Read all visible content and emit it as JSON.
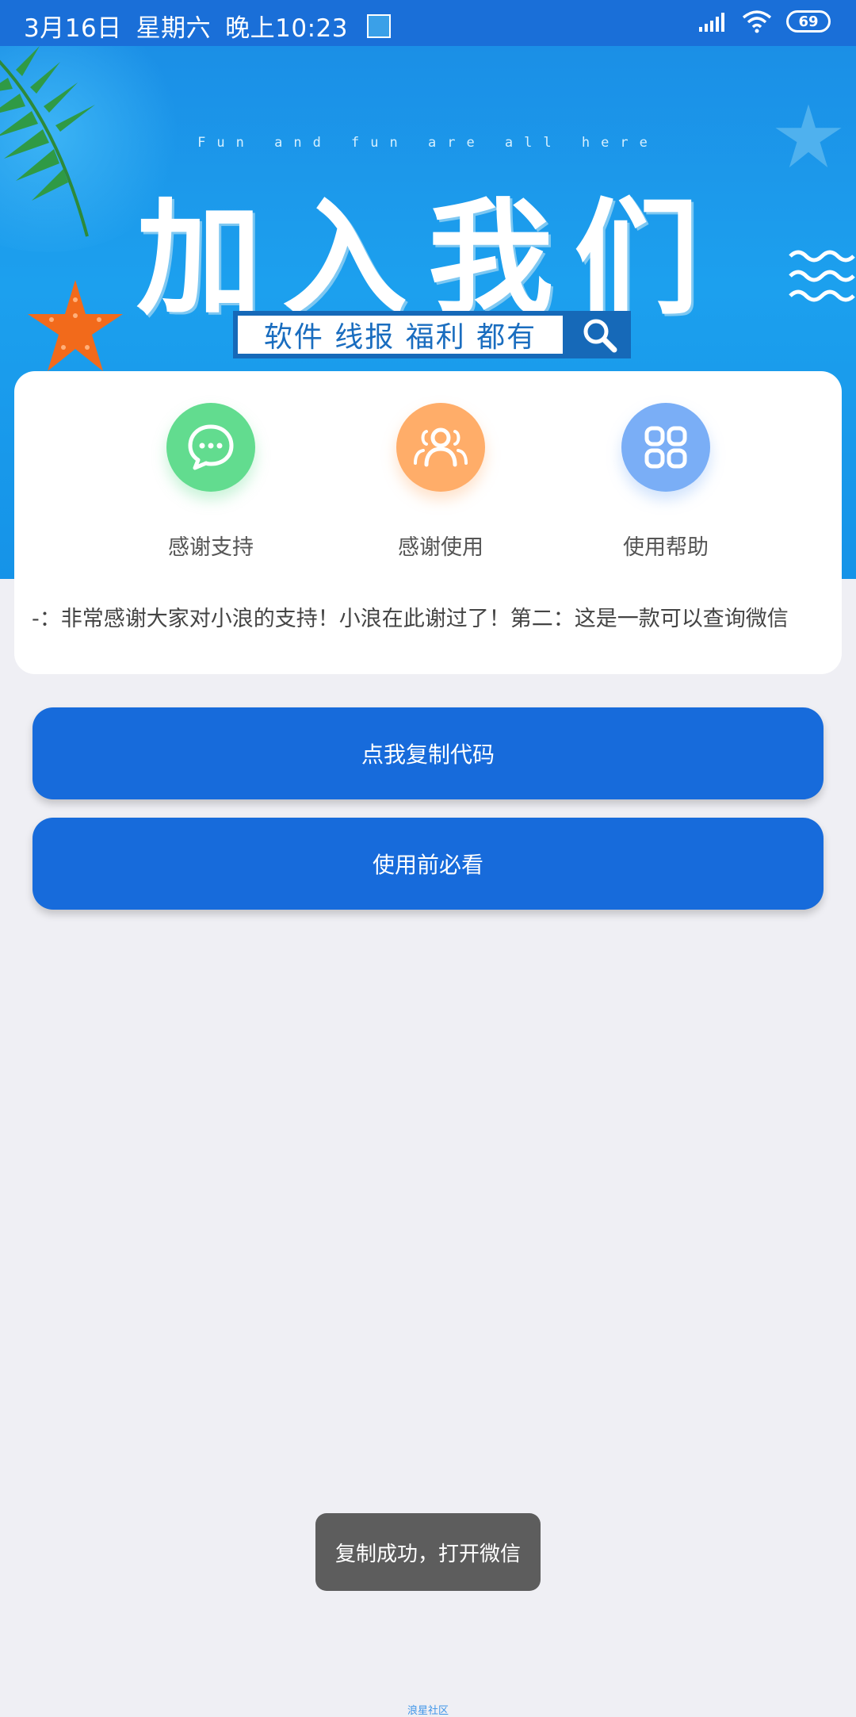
{
  "status_bar": {
    "date": "3月16日",
    "weekday": "星期六",
    "time": "晚上10:23",
    "battery": "69"
  },
  "banner": {
    "subtitle": "Fun and fun are all here",
    "title": "加入我们",
    "search_text": "软件 线报 福利 都有"
  },
  "features": [
    {
      "label": "感谢支持",
      "icon": "chat-icon",
      "color": "#62dc8f"
    },
    {
      "label": "感谢使用",
      "icon": "users-icon",
      "color": "#ffad69"
    },
    {
      "label": "使用帮助",
      "icon": "grid-icon",
      "color": "#7aaef6"
    }
  ],
  "notice": "-：非常感谢大家对小浪的支持！小浪在此谢过了！第二：这是一款可以查询微信",
  "buttons": {
    "copy_code": "点我复制代码",
    "must_read": "使用前必看"
  },
  "toast": "复制成功，打开微信",
  "footer": "浪星社区",
  "colors": {
    "primary": "#176bdb",
    "status_bar": "#1a6fd8",
    "background": "#efeff4"
  }
}
